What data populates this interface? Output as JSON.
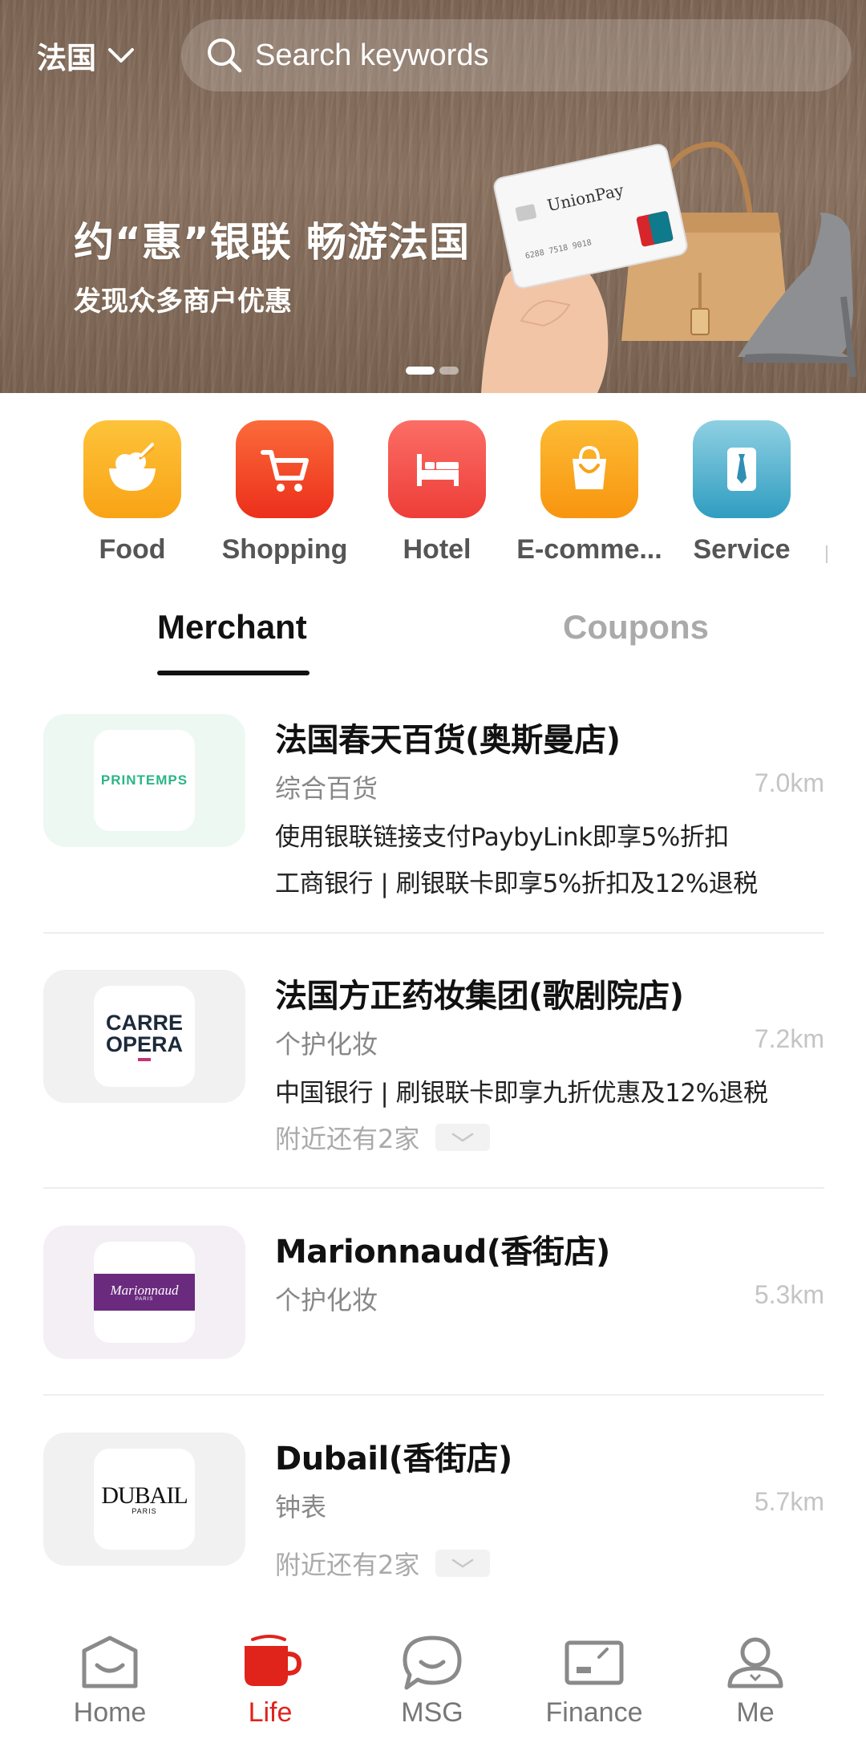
{
  "header": {
    "region": "法国",
    "search_placeholder": "Search keywords"
  },
  "banner": {
    "title": "约“惠”银联 畅游法国",
    "subtitle": "发现众多商户优惠",
    "card_brand": "UnionPay",
    "page_count": 2,
    "active_page": 1
  },
  "categories": [
    {
      "label": "Food",
      "icon": "rice-bowl-icon",
      "color": "#fbb421"
    },
    {
      "label": "Shopping",
      "icon": "cart-icon",
      "color": "#f54a28"
    },
    {
      "label": "Hotel",
      "icon": "bed-icon",
      "color": "#f4524b"
    },
    {
      "label": "E-comme...",
      "icon": "shopping-bag-icon",
      "color": "#fba417"
    },
    {
      "label": "Service",
      "icon": "tie-icon",
      "color": "#3aa6c7"
    }
  ],
  "tabs": {
    "merchant": "Merchant",
    "coupons": "Coupons"
  },
  "merchants": [
    {
      "name": "法国春天百货(奥斯曼店)",
      "category": "综合百货",
      "distance": "7.0km",
      "offers": [
        "使用银联链接支付PaybyLink即享5%折扣",
        "工商银行 | 刷银联卡即享5%折扣及12%退税"
      ],
      "logo_text": "PRINTEMPS",
      "tile_color": "#eef8f3"
    },
    {
      "name": "法国方正药妆集团(歌剧院店)",
      "category": "个护化妆",
      "distance": "7.2km",
      "offers": [
        "中国银行 | 刷银联卡即享九折优惠及12%退税"
      ],
      "nearby": "附近还有2家",
      "logo_text": [
        "CARRE",
        "OPERA"
      ],
      "tile_color": "#f1f1f1"
    },
    {
      "name": "Marionnaud(香街店)",
      "category": "个护化妆",
      "distance": "5.3km",
      "logo_text": [
        "Marionnaud",
        "PARIS"
      ],
      "tile_color": "#f3eff5"
    },
    {
      "name": "Dubail(香街店)",
      "category": "钟表",
      "distance": "5.7km",
      "nearby": "附近还有2家",
      "logo_text": [
        "DUBAIL",
        "PARIS"
      ],
      "tile_color": "#f1f1f1"
    }
  ],
  "nav": [
    {
      "label": "Home",
      "icon": "home-icon"
    },
    {
      "label": "Life",
      "icon": "cup-icon",
      "active": true
    },
    {
      "label": "MSG",
      "icon": "chat-bubble-icon"
    },
    {
      "label": "Finance",
      "icon": "card-icon"
    },
    {
      "label": "Me",
      "icon": "user-icon"
    }
  ],
  "colors": {
    "accent": "#e0231b",
    "text_primary": "#111111",
    "text_secondary": "#888888",
    "distance": "#c4c4c4"
  }
}
